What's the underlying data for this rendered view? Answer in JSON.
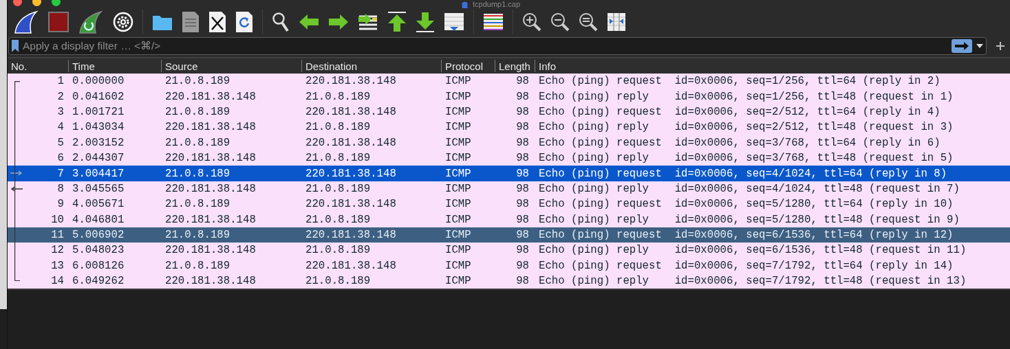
{
  "window": {
    "title": "tcpdump1.cap"
  },
  "filter": {
    "placeholder": "Apply a display filter … <⌘/>"
  },
  "table": {
    "columns": [
      "No.",
      "Time",
      "Source",
      "Destination",
      "Protocol",
      "Length",
      "Info"
    ],
    "rows": [
      {
        "no": "1",
        "time": "0.000000",
        "source": "21.0.8.189",
        "destination": "220.181.38.148",
        "protocol": "ICMP",
        "length": "98",
        "info": "Echo (ping) request  id=0x0006, seq=1/256, ttl=64 (reply in 2)",
        "selected": false,
        "highlighted": false,
        "related": false
      },
      {
        "no": "2",
        "time": "0.041602",
        "source": "220.181.38.148",
        "destination": "21.0.8.189",
        "protocol": "ICMP",
        "length": "98",
        "info": "Echo (ping) reply    id=0x0006, seq=1/256, ttl=48 (request in 1)",
        "selected": false,
        "highlighted": false,
        "related": false
      },
      {
        "no": "3",
        "time": "1.001721",
        "source": "21.0.8.189",
        "destination": "220.181.38.148",
        "protocol": "ICMP",
        "length": "98",
        "info": "Echo (ping) request  id=0x0006, seq=2/512, ttl=64 (reply in 4)",
        "selected": false,
        "highlighted": false,
        "related": false
      },
      {
        "no": "4",
        "time": "1.043034",
        "source": "220.181.38.148",
        "destination": "21.0.8.189",
        "protocol": "ICMP",
        "length": "98",
        "info": "Echo (ping) reply    id=0x0006, seq=2/512, ttl=48 (request in 3)",
        "selected": false,
        "highlighted": false,
        "related": false
      },
      {
        "no": "5",
        "time": "2.003152",
        "source": "21.0.8.189",
        "destination": "220.181.38.148",
        "protocol": "ICMP",
        "length": "98",
        "info": "Echo (ping) request  id=0x0006, seq=3/768, ttl=64 (reply in 6)",
        "selected": false,
        "highlighted": false,
        "related": false
      },
      {
        "no": "6",
        "time": "2.044307",
        "source": "220.181.38.148",
        "destination": "21.0.8.189",
        "protocol": "ICMP",
        "length": "98",
        "info": "Echo (ping) reply    id=0x0006, seq=3/768, ttl=48 (request in 5)",
        "selected": false,
        "highlighted": false,
        "related": false
      },
      {
        "no": "7",
        "time": "3.004417",
        "source": "21.0.8.189",
        "destination": "220.181.38.148",
        "protocol": "ICMP",
        "length": "98",
        "info": "Echo (ping) request  id=0x0006, seq=4/1024, ttl=64 (reply in 8)",
        "selected": true,
        "highlighted": false,
        "related": false
      },
      {
        "no": "8",
        "time": "3.045565",
        "source": "220.181.38.148",
        "destination": "21.0.8.189",
        "protocol": "ICMP",
        "length": "98",
        "info": "Echo (ping) reply    id=0x0006, seq=4/1024, ttl=48 (request in 7)",
        "selected": false,
        "highlighted": false,
        "related": true
      },
      {
        "no": "9",
        "time": "4.005671",
        "source": "21.0.8.189",
        "destination": "220.181.38.148",
        "protocol": "ICMP",
        "length": "98",
        "info": "Echo (ping) request  id=0x0006, seq=5/1280, ttl=64 (reply in 10)",
        "selected": false,
        "highlighted": false,
        "related": false
      },
      {
        "no": "10",
        "time": "4.046801",
        "source": "220.181.38.148",
        "destination": "21.0.8.189",
        "protocol": "ICMP",
        "length": "98",
        "info": "Echo (ping) reply    id=0x0006, seq=5/1280, ttl=48 (request in 9)",
        "selected": false,
        "highlighted": false,
        "related": false
      },
      {
        "no": "11",
        "time": "5.006902",
        "source": "21.0.8.189",
        "destination": "220.181.38.148",
        "protocol": "ICMP",
        "length": "98",
        "info": "Echo (ping) request  id=0x0006, seq=6/1536, ttl=64 (reply in 12)",
        "selected": false,
        "highlighted": true,
        "related": false
      },
      {
        "no": "12",
        "time": "5.048023",
        "source": "220.181.38.148",
        "destination": "21.0.8.189",
        "protocol": "ICMP",
        "length": "98",
        "info": "Echo (ping) reply    id=0x0006, seq=6/1536, ttl=48 (request in 11)",
        "selected": false,
        "highlighted": false,
        "related": false
      },
      {
        "no": "13",
        "time": "6.008126",
        "source": "21.0.8.189",
        "destination": "220.181.38.148",
        "protocol": "ICMP",
        "length": "98",
        "info": "Echo (ping) request  id=0x0006, seq=7/1792, ttl=64 (reply in 14)",
        "selected": false,
        "highlighted": false,
        "related": false
      },
      {
        "no": "14",
        "time": "6.049262",
        "source": "220.181.38.148",
        "destination": "21.0.8.189",
        "protocol": "ICMP",
        "length": "98",
        "info": "Echo (ping) reply    id=0x0006, seq=7/1792, ttl=48 (request in 13)",
        "selected": false,
        "highlighted": false,
        "related": false
      }
    ]
  }
}
